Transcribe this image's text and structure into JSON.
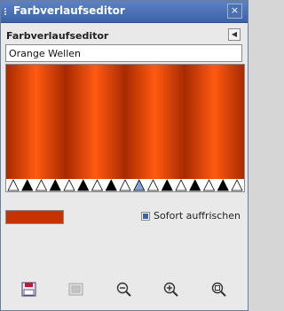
{
  "window": {
    "title": "Farbverlaufseditor",
    "close_glyph": "×"
  },
  "panel": {
    "title": "Farbverlaufseditor",
    "menu_glyph": "◀"
  },
  "gradient": {
    "name": "Orange Wellen"
  },
  "instant_update": {
    "label": "Sofort auffrischen",
    "checked": true
  },
  "colors": {
    "gradient_dark": "#a82a00",
    "gradient_light": "#ff5a10",
    "swatch": "#c73300",
    "selected_stop": "#7ea2d6"
  },
  "toolbar": {
    "buttons": [
      {
        "icon": "save-icon",
        "label": "Save",
        "enabled": true
      },
      {
        "icon": "revert-icon",
        "label": "Revert",
        "enabled": false
      },
      {
        "icon": "zoom-out-icon",
        "label": "Zoom out",
        "enabled": true
      },
      {
        "icon": "zoom-in-icon",
        "label": "Zoom in",
        "enabled": true
      },
      {
        "icon": "zoom-all-icon",
        "label": "Zoom all",
        "enabled": true
      }
    ]
  }
}
